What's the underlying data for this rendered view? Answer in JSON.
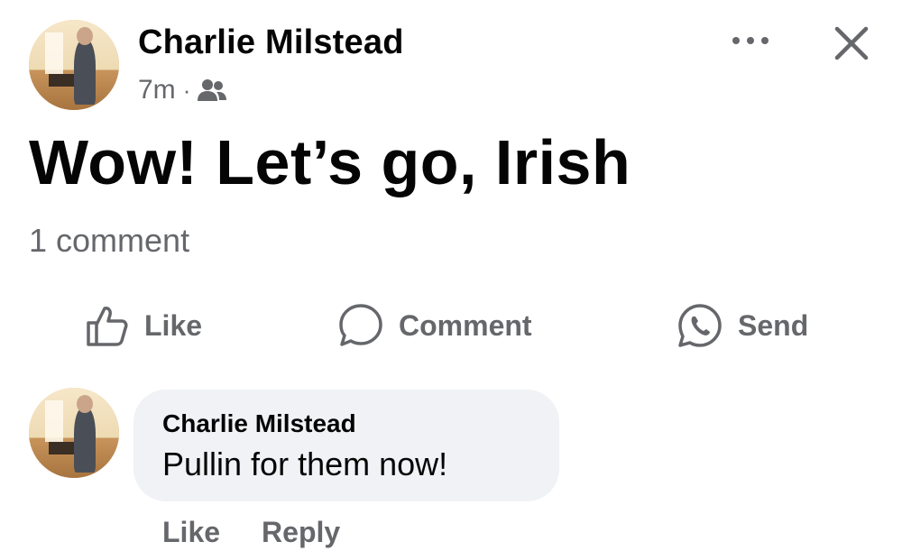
{
  "post": {
    "author": "Charlie Milstead",
    "time": "7m",
    "separator": "·",
    "audience_icon": "friends-icon",
    "text": "Wow! Let’s go, Irish",
    "comment_count": "1 comment"
  },
  "header_controls": {
    "more_icon": "more-horizontal-icon",
    "close_icon": "close-icon"
  },
  "actions": {
    "like_label": "Like",
    "comment_label": "Comment",
    "send_label": "Send"
  },
  "comment": {
    "author": "Charlie Milstead",
    "text": "Pullin for them now!",
    "like_label": "Like",
    "reply_label": "Reply"
  },
  "colors": {
    "text_primary": "#050505",
    "text_secondary": "#65676b",
    "bubble_bg": "#f0f2f5"
  }
}
